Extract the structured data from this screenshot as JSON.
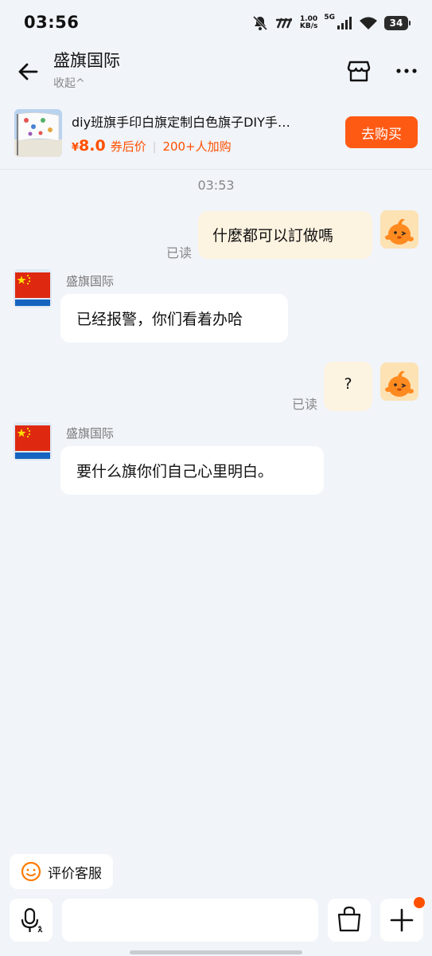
{
  "status_bar": {
    "time": "03:56",
    "net_speed_value": "1.00",
    "net_speed_unit": "KB/s",
    "network": "5G",
    "battery": "34"
  },
  "header": {
    "shop_name": "盛旗国际",
    "collapse_label": "收起^"
  },
  "product": {
    "title": "diy班旗手印白旗定制白色旗子DIY手…",
    "currency": "¥",
    "price": "8.0",
    "price_note": "券后价",
    "separator": "|",
    "buyers": "200+人加购",
    "buy_label": "去购买"
  },
  "chat": {
    "timestamp": "03:53",
    "messages": [
      {
        "from": "me",
        "text": "什麼都可以訂做嗎",
        "status": "已读"
      },
      {
        "from": "shop",
        "sender": "盛旗国际",
        "text": "已经报警，你们看着办哈"
      },
      {
        "from": "me",
        "text": "?",
        "status": "已读"
      },
      {
        "from": "shop",
        "sender": "盛旗国际",
        "text": "要什么旗你们自己心里明白。"
      }
    ]
  },
  "bottom": {
    "rate_label": "评价客服",
    "input_placeholder": ""
  },
  "colors": {
    "accent": "#ff5a14",
    "bubble_out": "#fdf3e1",
    "background": "#f1f4f9"
  }
}
